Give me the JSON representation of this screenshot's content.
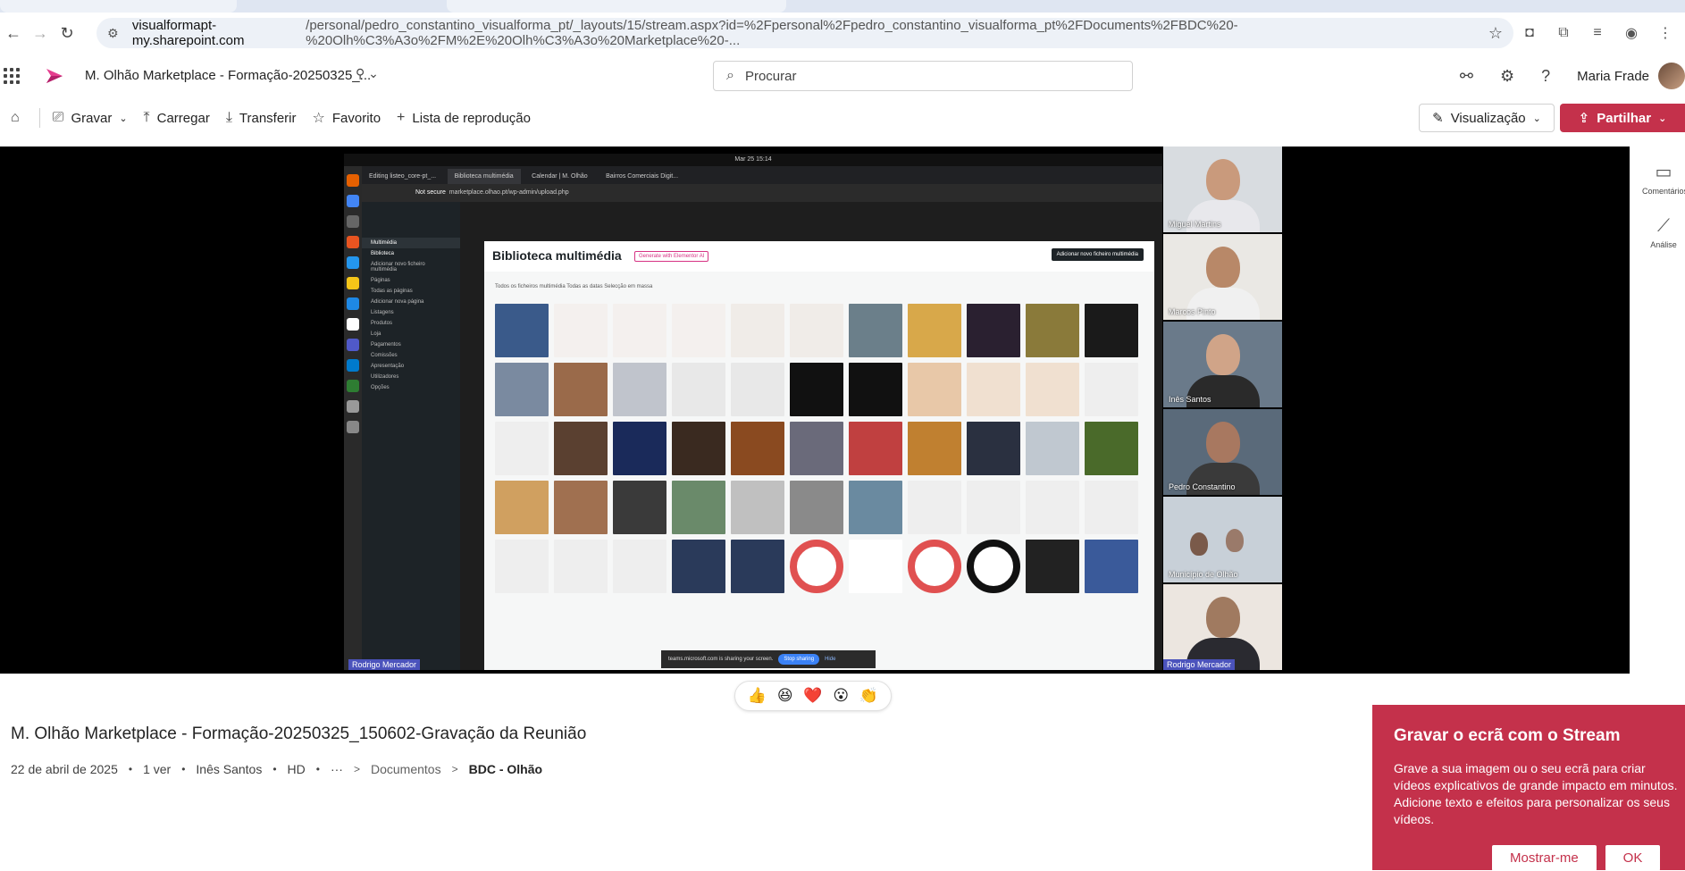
{
  "browser": {
    "url_host": "visualformapt-my.sharepoint.com",
    "url_path": "/personal/pedro_constantino_visualforma_pt/_layouts/15/stream.aspx?id=%2Fpersonal%2Fpedro_constantino_visualforma_pt%2FDocuments%2FBDC%20-%20Olh%C3%A3o%2FM%2E%20Olh%C3%A3o%20Marketplace%20-..."
  },
  "app": {
    "doc_title": "M. Olhão Marketplace - Formação-20250325_...",
    "search_placeholder": "Procurar",
    "user_name": "Maria Frade"
  },
  "toolbar": {
    "record": "Gravar",
    "upload": "Carregar",
    "download": "Transferir",
    "favorite": "Favorito",
    "playlist": "Lista de reprodução",
    "view": "Visualização",
    "share": "Partilhar"
  },
  "video": {
    "screen": {
      "clock": "Mar 25  15:14",
      "tabs": [
        "Editing listeo_core-pt_...",
        "Biblioteca multimédia",
        "Calendar | M. Olhão",
        "Bairros Comerciais Digit..."
      ],
      "address_secure": "Not secure",
      "address": "marketplace.olhao.pt/wp-admin/upload.php",
      "heading": "Biblioteca multimédia",
      "generate_btn": "Generate with Elementor AI",
      "add_btn": "Adicionar novo ficheiro multimédia",
      "filters": "Todos os ficheiros multimédia   Todas as datas   Selecção em massa",
      "sidebar": [
        "Multimédia",
        "Biblioteca",
        "Adicionar novo ficheiro multimédia",
        "Páginas",
        "Todas as páginas",
        "Adicionar nova página",
        "Listagens",
        "Produtos",
        "Loja",
        "Pagamentos",
        "Comissões",
        "Apresentação",
        "Utilizadores",
        "Opções"
      ],
      "share_notice": "teams.microsoft.com is sharing your screen.",
      "stop_sharing": "Stop sharing",
      "hide": "Hide",
      "presenter": "Rodrigo Mercador"
    },
    "participants": [
      "Miguel Martins",
      "Marcos Pinto",
      "Inês Santos",
      "Pedro Constantino",
      "Município de Olhão",
      "Rodrigo Mercador"
    ]
  },
  "rail": {
    "comments": "Comentários",
    "analytics": "Análise"
  },
  "reactions": [
    "👍",
    "😆",
    "❤️",
    "😮",
    "👏"
  ],
  "details": {
    "title": "M. Olhão Marketplace - Formação-20250325_150602-Gravação da Reunião",
    "date": "22 de abril de 2025",
    "views": "1 ver",
    "owner": "Inês Santos",
    "quality": "HD",
    "more": "···",
    "crumb1": "Documentos",
    "crumb2": "BDC - Olhão"
  },
  "promo": {
    "title": "Gravar o ecrã com o Stream",
    "body": "Grave a sua imagem ou o seu ecrã para criar vídeos explicativos de grande impacto em minutos. Adicione texto e efeitos para personalizar os seus vídeos.",
    "show_btn": "Mostrar-me",
    "ok_btn": "OK"
  },
  "colors": {
    "accent": "#c4314b",
    "stream_brand": "#e53e8f"
  }
}
